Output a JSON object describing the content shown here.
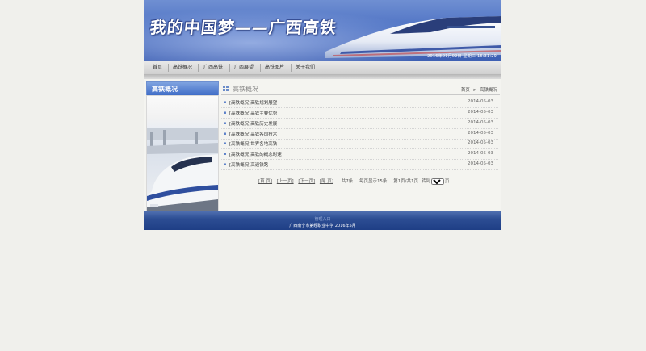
{
  "banner": {
    "slogan": "我的中国梦——广西高铁",
    "datetime": "2016年01月02日 星期二 16:31:29"
  },
  "nav": {
    "items": [
      "首页",
      "高铁概况",
      "广西高铁",
      "广西展望",
      "高铁图片",
      "关于我们"
    ]
  },
  "sidebar": {
    "title": "高铁概况"
  },
  "main": {
    "title": "高铁概况",
    "breadcrumb": {
      "home": "首页",
      "sep": ">",
      "current": "高铁概况"
    },
    "rows": [
      {
        "title": "[高铁概况]高铁规划展望",
        "date": "2014-05-03"
      },
      {
        "title": "[高铁概况]高铁主要优势",
        "date": "2014-05-03"
      },
      {
        "title": "[高铁概况]高铁历史发展",
        "date": "2014-05-03"
      },
      {
        "title": "[高铁概况]高铁各国技术",
        "date": "2014-05-03"
      },
      {
        "title": "[高铁概况]世界各地高铁",
        "date": "2014-05-03"
      },
      {
        "title": "[高铁概况]高铁的概念时速",
        "date": "2014-05-03"
      },
      {
        "title": "[高铁概况]高速铁路",
        "date": "2014-05-03"
      }
    ]
  },
  "pager": {
    "first": "[首 页]",
    "prev": "[上一页]",
    "next": "[下一页]",
    "last": "[尾 页]",
    "total": "共7条",
    "per_page": "每页显示15条",
    "page_of": "第1页/共1页",
    "goto": "转到",
    "selected": "1",
    "page_suffix": "页"
  },
  "footer": {
    "line1": "管理入口",
    "line2": "广西南宁市第经职业中学 2016年5月"
  },
  "colors": {
    "banner_blue": "#4f73c4",
    "footer_blue": "#1f3f86",
    "accent": "#3f6cc7"
  }
}
